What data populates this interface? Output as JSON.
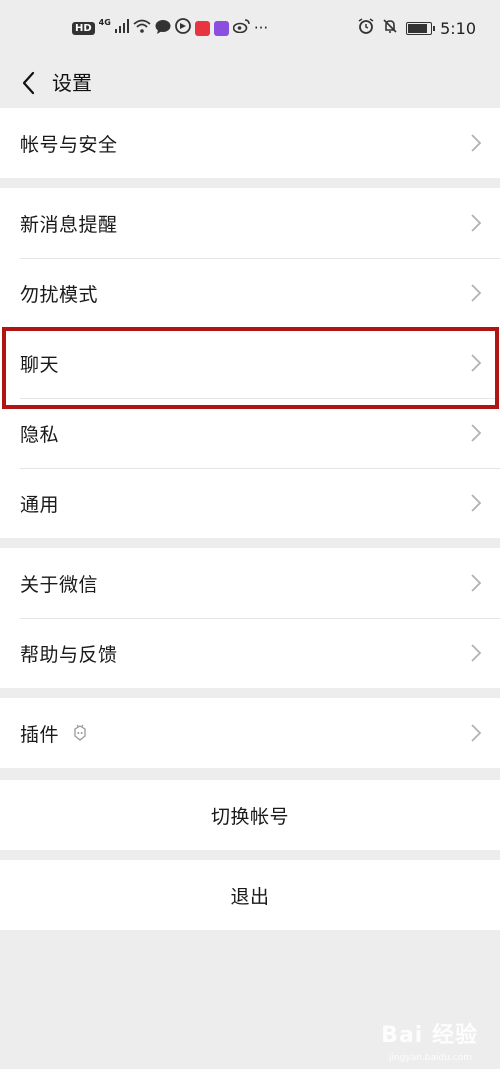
{
  "status_bar": {
    "network_badge": "HD",
    "network_type": "4G",
    "time": "5:10",
    "icons": [
      "signal-icon",
      "wifi-icon",
      "chat-bubble-icon",
      "browser-icon",
      "red-app-icon",
      "video-app-icon",
      "weibo-icon",
      "more-icon",
      "alarm-icon",
      "mute-icon",
      "battery-icon"
    ],
    "more_label": "···"
  },
  "nav": {
    "title": "设置",
    "back_icon": "chevron-left-icon"
  },
  "groups": {
    "account": {
      "item_0": "帐号与安全"
    },
    "notifications": {
      "item_0": "新消息提醒",
      "item_1": "勿扰模式",
      "item_2": "聊天",
      "item_3": "隐私",
      "item_4": "通用"
    },
    "about": {
      "item_0": "关于微信",
      "item_1": "帮助与反馈"
    },
    "plugins": {
      "item_0": "插件"
    }
  },
  "actions": {
    "switch_account": "切换帐号",
    "logout": "退出"
  },
  "watermark": {
    "text": "Bai 经验",
    "sub": "jingyan.baidu.com"
  },
  "colors": {
    "background": "#ededed",
    "row_background": "#ffffff",
    "highlight_border": "#b01512",
    "chevron": "#b2b2b2"
  }
}
